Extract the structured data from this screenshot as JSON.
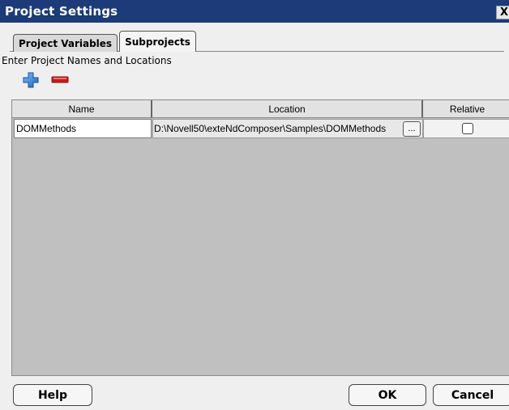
{
  "window": {
    "title": "Project Settings",
    "close_label": "X"
  },
  "tabs": [
    {
      "label": "Project Variables",
      "active": false
    },
    {
      "label": "Subprojects",
      "active": true
    }
  ],
  "instruction": "Enter Project Names and Locations",
  "toolbar": {
    "add_icon": "plus-icon",
    "remove_icon": "minus-icon",
    "add_color": "#2f7fd6",
    "remove_color": "#d01818"
  },
  "table": {
    "columns": [
      "Name",
      "Location",
      "Relative"
    ],
    "rows": [
      {
        "name": "DOMMethods",
        "location": "D:\\Novell50\\exteNdComposer\\Samples\\DOMMethods",
        "browse_label": "...",
        "relative": false
      }
    ]
  },
  "buttons": {
    "help": "Help",
    "ok": "OK",
    "cancel": "Cancel"
  },
  "colors": {
    "titlebar": "#1c3b78",
    "grid_bg": "#c0c0c0",
    "dialog_bg": "#efefef"
  }
}
